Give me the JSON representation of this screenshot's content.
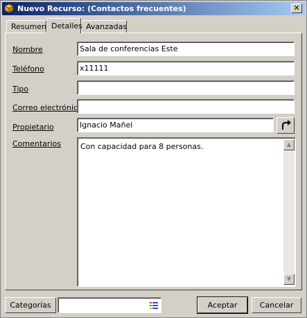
{
  "window": {
    "title": "Nuevo Recurso:  (Contactos frecuentes)",
    "close_label": "✕"
  },
  "tabs": [
    {
      "label": "Resumen",
      "active": false
    },
    {
      "label": "Detalles",
      "active": true
    },
    {
      "label": "Avanzadas",
      "active": false
    }
  ],
  "form": {
    "nombre": {
      "label": "Nombre",
      "value": "Sala de conferencias Este"
    },
    "telefono": {
      "label": "Teléfono",
      "value": "x11111"
    },
    "tipo": {
      "label": "Tipo",
      "value": ""
    },
    "correo": {
      "label": "Correo electrónico",
      "value": ""
    },
    "propietario": {
      "label": "Propietario",
      "value": "Ignacio Mañel"
    },
    "comentarios": {
      "label": "Comentarios",
      "value": "Con capacidad para 8 personas."
    }
  },
  "footer": {
    "categorias_label": "Categorías",
    "categorias_value": "",
    "aceptar_label": "Aceptar",
    "cancelar_label": "Cancelar"
  },
  "icons": {
    "title": "resource-cube-icon",
    "owner": "redirect-arrow-icon",
    "categories": "color-list-icon"
  }
}
